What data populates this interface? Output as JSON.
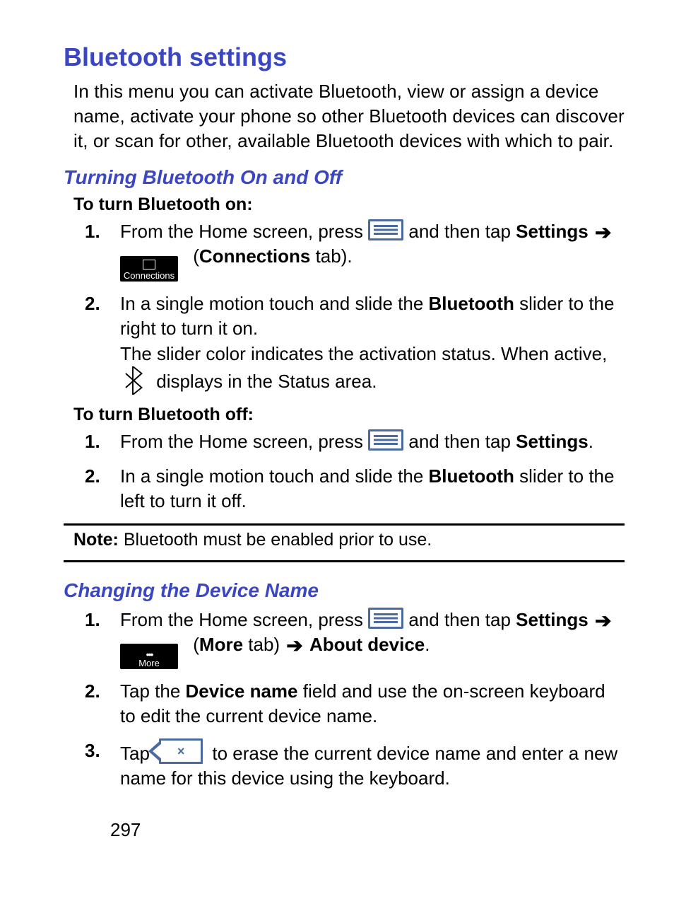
{
  "title": "Bluetooth settings",
  "lead": "In this menu you can activate Bluetooth, view or assign a device name, activate your phone so other Bluetooth devices can discover it, or scan for other, available Bluetooth devices with which to pair.",
  "section_on_off": {
    "heading": "Turning Bluetooth On and Off",
    "on_label": "To turn Bluetooth on:",
    "off_label": "To turn Bluetooth off:",
    "on_steps": {
      "s1_pre": "From the Home screen, press ",
      "s1_mid": " and then tap ",
      "settings": "Settings",
      "connections_bold": "Connections",
      "connections_suffix": " tab).",
      "connections_prefix": "(",
      "s2_pre": "In a single motion touch and slide the ",
      "bluetooth": "Bluetooth",
      "s2_post": " slider to the right to turn it on.",
      "s2_line2": "The slider color indicates the activation status. When active, ",
      "s2_line2_post": " displays in the Status area."
    },
    "off_steps": {
      "s1_pre": "From the Home screen, press ",
      "s1_mid": " and then tap ",
      "settings": "Settings",
      "period": ".",
      "s2_pre": "In a single motion touch and slide the ",
      "bluetooth": "Bluetooth",
      "s2_post": " slider to the left to turn it off."
    }
  },
  "note": {
    "label": "Note:",
    "text": " Bluetooth must be enabled prior to use."
  },
  "section_name": {
    "heading": "Changing the Device Name",
    "steps": {
      "s1_pre": "From the Home screen, press ",
      "s1_mid": " and then tap ",
      "settings": "Settings",
      "more_prefix": "(",
      "more_bold": "More",
      "more_suffix": " tab) ",
      "about_device": "About device",
      "period": ".",
      "s2_pre": "Tap the ",
      "device_name": "Device name",
      "s2_post": " field and use the on-screen keyboard to edit the current device name.",
      "s3_pre": "Tap  ",
      "s3_post": "  to erase the current device name and enter a new name for this device using the keyboard."
    }
  },
  "icons": {
    "connections_label": "Connections",
    "more_label": "More"
  },
  "nums": {
    "n1": "1.",
    "n2": "2.",
    "n3": "3."
  },
  "arrow": "➔",
  "page": "297"
}
